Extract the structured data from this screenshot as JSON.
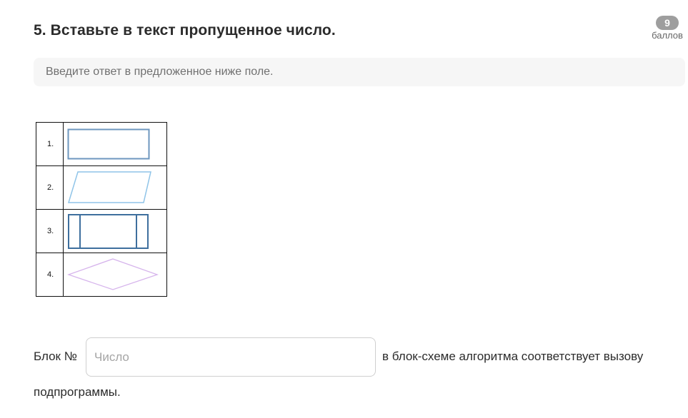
{
  "question": {
    "title": "5. Вставьте в текст пропущенное число.",
    "hint": "Введите ответ в предложенное ниже поле."
  },
  "score": {
    "value": "9",
    "label": "баллов"
  },
  "shapes_table": {
    "rows": [
      {
        "number": "1.",
        "shape": "rectangle-icon"
      },
      {
        "number": "2.",
        "shape": "parallelogram-icon"
      },
      {
        "number": "3.",
        "shape": "predefined-process-icon"
      },
      {
        "number": "4.",
        "shape": "rhombus-icon"
      }
    ]
  },
  "answer": {
    "label_before": "Блок №",
    "input_placeholder": "Число",
    "input_value": "",
    "label_after": "в блок-схеме алгоритма соответствует вызову",
    "label_tail": "подпрограммы."
  },
  "colors": {
    "rectangle_stroke": "#6e97bf",
    "parallelogram_stroke": "#8fc4e8",
    "predefined_stroke": "#3e6f9e",
    "rhombus_stroke": "#d6b4ec"
  }
}
